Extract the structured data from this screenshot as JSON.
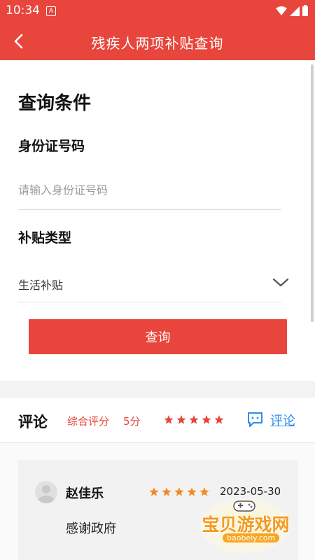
{
  "status_bar": {
    "time": "10:34",
    "notification_letter": "A"
  },
  "app_bar": {
    "title": "残疾人两项补贴查询"
  },
  "query_form": {
    "section_title": "查询条件",
    "id_label": "身份证号码",
    "id_placeholder": "请输入身份证号码",
    "id_value": "",
    "subsidy_label": "补贴类型",
    "subsidy_selected": "生活补贴",
    "submit_label": "查询"
  },
  "reviews": {
    "title": "评论",
    "score_label": "综合评分",
    "score_value": "5分",
    "rating_stars": 5,
    "comment_link": "评论",
    "items": [
      {
        "name": "赵佳乐",
        "stars": 5,
        "date": "2023-05-30",
        "text": "感谢政府"
      }
    ]
  },
  "watermark": {
    "text": "宝贝游戏网",
    "url": "baobeiy.com"
  },
  "colors": {
    "brand_red": "#e8453c",
    "star_red": "#e8453c",
    "star_orange": "#f08a24",
    "link_blue": "#2d8cf0"
  }
}
